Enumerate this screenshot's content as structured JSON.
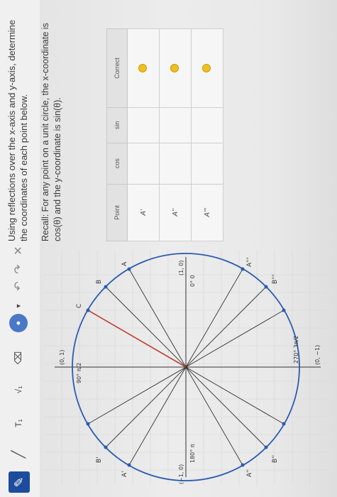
{
  "toolbar": {
    "text_tool": "T₁",
    "sqrt_tool": "√₁"
  },
  "question": {
    "instruction": "Using reflections over the x-axis and y-axis, determine the coordinates of each point below.",
    "recall": "Recall: For any point on a unit circle, the x-coordinate is cos(θ) and the y-coordinate is sin(θ)."
  },
  "table": {
    "headers": [
      "Point",
      "cos",
      "sin",
      "Correct"
    ],
    "rows": [
      {
        "point": "A'",
        "cos": "",
        "sin": ""
      },
      {
        "point": "A''",
        "cos": "",
        "sin": ""
      },
      {
        "point": "A'''",
        "cos": "",
        "sin": ""
      }
    ]
  },
  "diagram": {
    "axis_labels": {
      "top": "(0, 1)",
      "bottom": "(0, −1)",
      "left": "(−1, 0)",
      "right": "(1, 0)"
    },
    "angle_labels": {
      "a90": "90° π/2",
      "a180": "180° π",
      "a270": "270° 3π/2",
      "a0": "0° 0"
    },
    "point_labels": {
      "A": "A",
      "A1": "A'",
      "A2": "A''",
      "A3": "A'''",
      "B": "B",
      "B1": "B'",
      "B2": "B''",
      "B3": "B'''",
      "C": "C"
    }
  },
  "colors": {
    "accent": "#1d4c9c",
    "circle": "#2a5bb0",
    "red_line": "#c0392b",
    "correct_icon": "#f0c020"
  }
}
